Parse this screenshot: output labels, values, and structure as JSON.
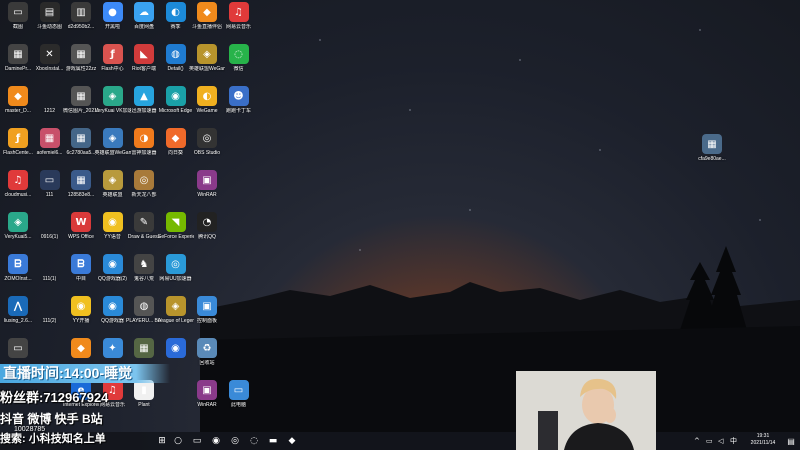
{
  "desktop": {
    "icons": [
      {
        "label": "截图",
        "glyph": "▭",
        "color": "#3a3a3a"
      },
      {
        "label": "斗鱼动态图",
        "glyph": "▤",
        "color": "#2a2a2a"
      },
      {
        "label": "d2d950b2...",
        "glyph": "▥",
        "color": "#3a3a3a"
      },
      {
        "label": "开黑啦",
        "glyph": "●",
        "color": "#3d8af7"
      },
      {
        "label": "百度网盘",
        "glyph": "☁",
        "color": "#3aa2f0"
      },
      {
        "label": "赛季",
        "glyph": "◐",
        "color": "#1c8ad8"
      },
      {
        "label": "斗鱼直播伴侣",
        "glyph": "◆",
        "color": "#f08a1c"
      },
      {
        "label": "网易云音乐",
        "glyph": "♫",
        "color": "#e03a3a"
      },
      {
        "label": "DaminePr...",
        "glyph": "▦",
        "color": "#444"
      },
      {
        "label": "XboxInstal...",
        "glyph": "✕",
        "color": "#2b2b2b"
      },
      {
        "label": "游戏属性22zz",
        "glyph": "▦",
        "color": "#555"
      },
      {
        "label": "Flash中心",
        "glyph": "ƒ",
        "color": "#d9534f"
      },
      {
        "label": "Riot客户端",
        "glyph": "◣",
        "color": "#d13b3b"
      },
      {
        "label": "Detail()",
        "glyph": "◍",
        "color": "#1f7bd0"
      },
      {
        "label": "英雄联盟WeGame版",
        "glyph": "◈",
        "color": "#b8942c"
      },
      {
        "label": "微信",
        "glyph": "◌",
        "color": "#27b34a"
      },
      {
        "label": "master_D...",
        "glyph": "◆",
        "color": "#f08a1c"
      },
      {
        "label": "1212",
        "glyph": "",
        "color": "transparent"
      },
      {
        "label": "微信图片_2021117...",
        "glyph": "▦",
        "color": "#555"
      },
      {
        "label": "VeryKuai VK加速器",
        "glyph": "◈",
        "color": "#2aa88a"
      },
      {
        "label": "迅游加速器",
        "glyph": "▲",
        "color": "#27a4de"
      },
      {
        "label": "Microsoft Edge",
        "glyph": "◉",
        "color": "#1aa1a8"
      },
      {
        "label": "WeGame",
        "glyph": "◐",
        "color": "#f0b020"
      },
      {
        "label": "跑跑卡丁车",
        "glyph": "☻",
        "color": "#3a6fc8"
      },
      {
        "label": "FlashCente...",
        "glyph": "ƒ",
        "color": "#f0a020"
      },
      {
        "label": "aofemiel6...",
        "glyph": "▦",
        "color": "#c8506a"
      },
      {
        "label": "6c2780aa5...",
        "glyph": "▦",
        "color": "#446688"
      },
      {
        "label": "英雄联盟WeGame版",
        "glyph": "◈",
        "color": "#3a7abd"
      },
      {
        "label": "雷神加速器",
        "glyph": "◑",
        "color": "#f07a1c"
      },
      {
        "label": "向日葵",
        "glyph": "◆",
        "color": "#f06a2a"
      },
      {
        "label": "OBS Studio",
        "glyph": "◎",
        "color": "#333"
      },
      {
        "label": "",
        "glyph": "",
        "color": "transparent"
      },
      {
        "label": "cloudmusi...",
        "glyph": "♫",
        "color": "#e03a3a"
      },
      {
        "label": "111",
        "glyph": "▭",
        "color": "#2a3a5a"
      },
      {
        "label": "128583e8...",
        "glyph": "▦",
        "color": "#3a5a8a"
      },
      {
        "label": "英雄联盟",
        "glyph": "◈",
        "color": "#b89a3c"
      },
      {
        "label": "新天龙八部",
        "glyph": "◎",
        "color": "#a87a3a"
      },
      {
        "label": "",
        "glyph": "",
        "color": "transparent"
      },
      {
        "label": "WinRAR",
        "glyph": "▣",
        "color": "#8a3a8a"
      },
      {
        "label": "",
        "glyph": "",
        "color": "transparent"
      },
      {
        "label": "VeryKuai5...",
        "glyph": "◈",
        "color": "#2aa88a"
      },
      {
        "label": "0916(1)",
        "glyph": "",
        "color": "transparent"
      },
      {
        "label": "WPS Office",
        "glyph": "W",
        "color": "#d93a3a"
      },
      {
        "label": "YY语音",
        "glyph": "◉",
        "color": "#f0c020"
      },
      {
        "label": "Draw & Guess",
        "glyph": "✎",
        "color": "#3a3a3a"
      },
      {
        "label": "GeForce Experience",
        "glyph": "◥",
        "color": "#76b900"
      },
      {
        "label": "腾讯QQ",
        "glyph": "◔",
        "color": "#222"
      },
      {
        "label": "",
        "glyph": "",
        "color": "transparent"
      },
      {
        "label": "ZOMOInst...",
        "glyph": "ᗷ",
        "color": "#3a7ad8"
      },
      {
        "label": "111(1)",
        "glyph": "",
        "color": "transparent"
      },
      {
        "label": "中目",
        "glyph": "ᗷ",
        "color": "#3a7ad8"
      },
      {
        "label": "QQ游戏器(2)",
        "glyph": "◉",
        "color": "#2a8ad8"
      },
      {
        "label": "鬼谷八荒",
        "glyph": "♞",
        "color": "#444"
      },
      {
        "label": "网易UU加速器",
        "glyph": "◎",
        "color": "#2a9ad8"
      },
      {
        "label": "",
        "glyph": "",
        "color": "transparent"
      },
      {
        "label": "",
        "glyph": "",
        "color": "transparent"
      },
      {
        "label": "liusing_2.6...",
        "glyph": "⋀",
        "color": "#1a6ab8"
      },
      {
        "label": "111(2)",
        "glyph": "",
        "color": "transparent"
      },
      {
        "label": "YY开播",
        "glyph": "◉",
        "color": "#f0c020"
      },
      {
        "label": "QQ游戏器",
        "glyph": "◉",
        "color": "#2a8ad8"
      },
      {
        "label": "PLAYERU... BATTLEGR...",
        "glyph": "◍",
        "color": "#555"
      },
      {
        "label": "League of Legends",
        "glyph": "◈",
        "color": "#b8942c"
      },
      {
        "label": "控制面板",
        "glyph": "▣",
        "color": "#3a8ad8"
      },
      {
        "label": "",
        "glyph": "",
        "color": "transparent"
      },
      {
        "label": "",
        "glyph": "▭",
        "color": "#444"
      },
      {
        "label": "",
        "glyph": "",
        "color": "transparent"
      },
      {
        "label": "",
        "glyph": "◆",
        "color": "#f08a1c"
      },
      {
        "label": "",
        "glyph": "✦",
        "color": "#3a8ad8"
      },
      {
        "label": "",
        "glyph": "▦",
        "color": "#556644"
      },
      {
        "label": "",
        "glyph": "◉",
        "color": "#2a6ad8"
      },
      {
        "label": "回收站",
        "glyph": "♻",
        "color": "#5a8ab8"
      },
      {
        "label": "",
        "glyph": "",
        "color": "transparent"
      },
      {
        "label": "",
        "glyph": "",
        "color": "transparent"
      },
      {
        "label": "",
        "glyph": "",
        "color": "transparent"
      },
      {
        "label": "Internet Explorer",
        "glyph": "e",
        "color": "#1a6ad8"
      },
      {
        "label": "网易云音乐",
        "glyph": "♫",
        "color": "#e03a3a"
      },
      {
        "label": "Plant",
        "glyph": "▮",
        "color": "#f0f0f0"
      },
      {
        "label": "",
        "glyph": "",
        "color": "transparent"
      },
      {
        "label": "WinRAR",
        "glyph": "▣",
        "color": "#8a3a8a"
      },
      {
        "label": "此电脑",
        "glyph": "▭",
        "color": "#3a8ad8"
      }
    ],
    "extra_icon": {
      "label": "cfa9e80ae...",
      "glyph": "▦",
      "color": "#4a6a8a"
    }
  },
  "overlays": {
    "schedule": "直播时间:14:00-睡觉",
    "fans": "粉丝群:712967924",
    "social_text": "抖音     微博      快手      B站",
    "id_text": "10028785",
    "search": "搜索:  小科技知名上单"
  },
  "taskbar": {
    "start_icon": "start-icon",
    "items": [
      {
        "name": "search-icon",
        "glyph": "○"
      },
      {
        "name": "task-view-icon",
        "glyph": "▭"
      },
      {
        "name": "edge-icon",
        "glyph": "◉"
      },
      {
        "name": "yy-icon",
        "glyph": "◎"
      },
      {
        "name": "wechat-icon",
        "glyph": "◌"
      },
      {
        "name": "explorer-icon",
        "glyph": "▬"
      },
      {
        "name": "douyu-icon",
        "glyph": "◆"
      }
    ],
    "tray_chevron": "^",
    "clock_time": "19:31",
    "clock_date": "2021/11/14",
    "notification_icon": "▤"
  }
}
